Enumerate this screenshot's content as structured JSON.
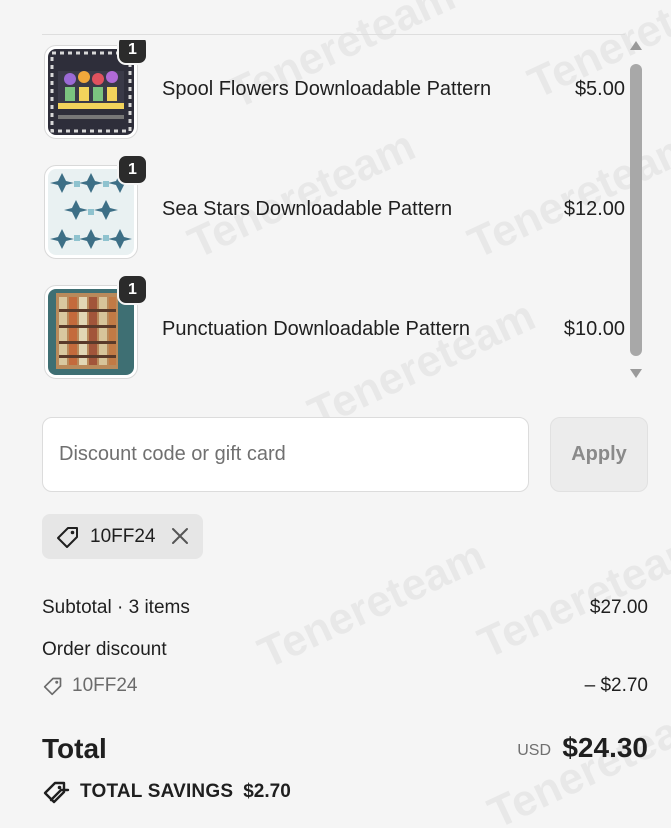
{
  "cart": {
    "items": [
      {
        "name": "Spool Flowers Downloadable Pattern",
        "price": "$5.00",
        "qty": "1",
        "thumb_icon": "spool-flowers-thumbnail"
      },
      {
        "name": "Sea Stars Downloadable Pattern",
        "price": "$12.00",
        "qty": "1",
        "thumb_icon": "sea-stars-thumbnail"
      },
      {
        "name": "Punctuation Downloadable Pattern",
        "price": "$10.00",
        "qty": "1",
        "thumb_icon": "punctuation-thumbnail"
      }
    ]
  },
  "discount": {
    "placeholder": "Discount code or gift card",
    "apply_label": "Apply",
    "applied_code": "10FF24"
  },
  "summary": {
    "subtotal_label": "Subtotal · 3 items",
    "subtotal_value": "$27.00",
    "order_discount_label": "Order discount",
    "order_discount_code": "10FF24",
    "order_discount_value": "– $2.70",
    "total_label": "Total",
    "currency": "USD",
    "total_value": "$24.30",
    "savings_label": "TOTAL SAVINGS",
    "savings_value": "$2.70"
  },
  "colors": {
    "background": "#f5f5f5",
    "text": "#1f1f1f",
    "badge": "#2b2b2b",
    "muted": "#6b6b6b"
  },
  "watermark_text": "Tenereteam"
}
